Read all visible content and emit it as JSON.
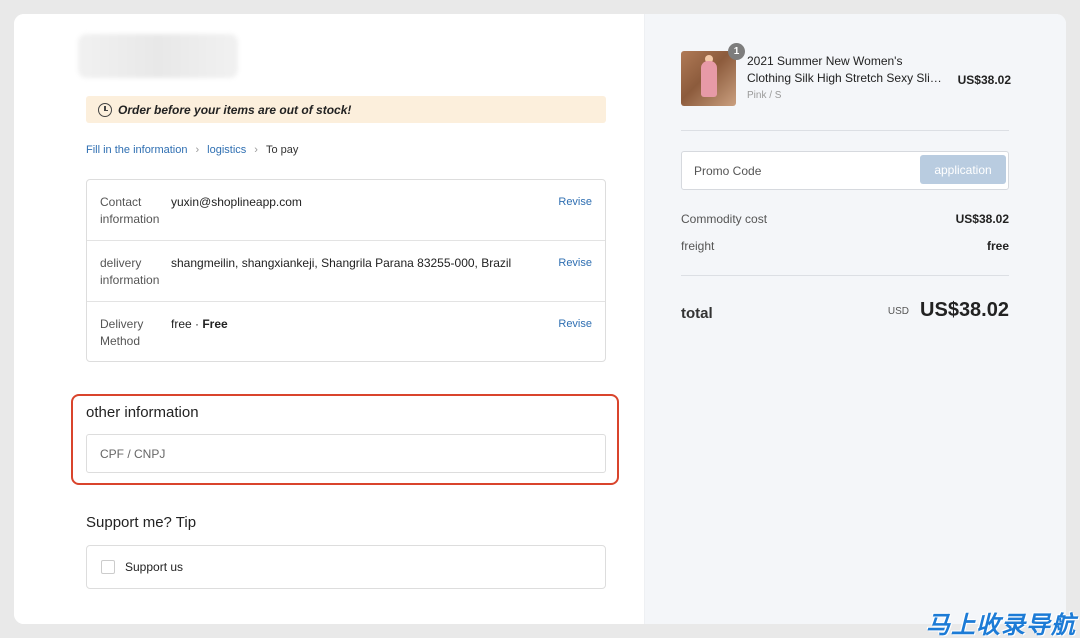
{
  "notice": {
    "text": "Order before your items are out of stock!",
    "icon": "clock-icon"
  },
  "breadcrumb": {
    "items": [
      {
        "label": "Fill in the information"
      },
      {
        "label": "logistics"
      },
      {
        "label": "To pay"
      }
    ]
  },
  "info_rows": [
    {
      "label_line1": "Contact",
      "label_line2": "information",
      "value": "yuxin@shoplineapp.com",
      "action": "Revise"
    },
    {
      "label_line1": "delivery",
      "label_line2": "information",
      "value": "shangmeilin, shangxiankeji, Shangrila Parana 83255-000, Brazil",
      "action": "Revise"
    },
    {
      "label_line1": "Delivery",
      "label_line2": "Method",
      "value_prefix": "free · ",
      "value_bold": "Free",
      "action": "Revise"
    }
  ],
  "other_info": {
    "title": "other information",
    "placeholder": "CPF / CNPJ"
  },
  "support": {
    "title": "Support me? Tip",
    "checkbox_label": "Support us"
  },
  "cart": {
    "quantity": "1",
    "product_line1": "2021 Summer New Women's",
    "product_line2": "Clothing Silk High Stretch Sexy Slim Dress",
    "variant": "Pink / S",
    "price": "US$38.02"
  },
  "promo": {
    "placeholder": "Promo Code",
    "button": "application"
  },
  "costs": {
    "commodity_label": "Commodity cost",
    "commodity_value": "US$38.02",
    "freight_label": "freight",
    "freight_value": "free"
  },
  "total": {
    "label": "total",
    "currency": "USD",
    "amount": "US$38.02"
  },
  "watermark": "马上收录导航",
  "colors": {
    "link": "#2f6fb2",
    "highlight_border": "#d9442c",
    "notice_bg": "#fcefdc",
    "promo_button": "#b9cce0"
  }
}
